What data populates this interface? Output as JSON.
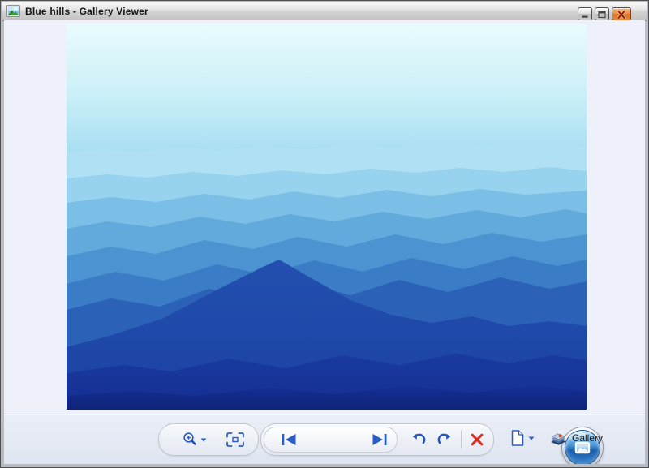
{
  "window": {
    "title": "Blue hills - Gallery Viewer",
    "title_icon": "picture-icon",
    "buttons": [
      {
        "name": "minimize-button",
        "icon": "minimize-icon"
      },
      {
        "name": "maximize-button",
        "icon": "maximize-icon"
      },
      {
        "name": "close-button",
        "icon": "close-icon"
      }
    ]
  },
  "viewer": {
    "image_name": "Blue hills"
  },
  "toolbar": {
    "buttons": [
      {
        "name": "zoom-button",
        "icon": "magnifier-plus-icon",
        "has_dropdown": true
      },
      {
        "name": "fit-to-window-button",
        "icon": "fit-to-window-icon"
      },
      {
        "name": "previous-button",
        "icon": "previous-icon"
      },
      {
        "name": "play-slideshow-button",
        "icon": "slideshow-icon"
      },
      {
        "name": "next-button",
        "icon": "next-icon"
      },
      {
        "name": "rotate-counterclockwise-button",
        "icon": "rotate-ccw-icon"
      },
      {
        "name": "rotate-clockwise-button",
        "icon": "rotate-cw-icon"
      },
      {
        "name": "delete-button",
        "icon": "delete-x-icon"
      },
      {
        "name": "file-menu-button",
        "icon": "file-page-icon",
        "has_dropdown": true
      },
      {
        "name": "gallery-button",
        "icon": "photo-stack-icon",
        "label": "Gallery"
      }
    ],
    "gallery_label": "Gallery"
  },
  "colors": {
    "icon_blue": "#2a5ec4",
    "delete_red": "#dd2a1c",
    "close_button_orange": "#e8823a",
    "play_button_blue": "#2f79c6",
    "titlebar_text": "#141414",
    "client_background": "#eef1f9"
  }
}
